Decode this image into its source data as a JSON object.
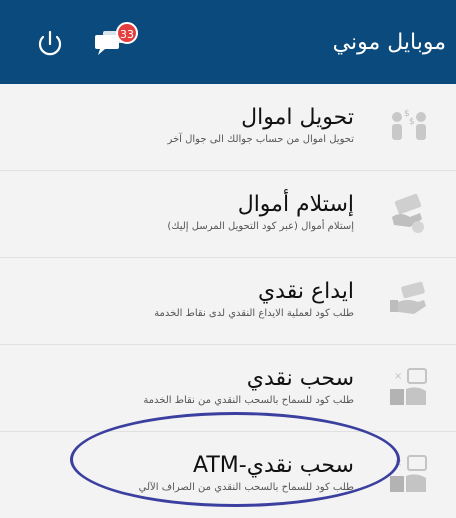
{
  "header": {
    "title": "موبايل موني",
    "notification_count": "33"
  },
  "items": [
    {
      "title": "تحويل اموال",
      "desc": "تحويل اموال من حساب جوالك الى جوال آخر",
      "icon": "money-transfer-icon"
    },
    {
      "title": "إستلام أموال",
      "desc": "إستلام أموال (عبر كود التحويل المرسل إليك)",
      "icon": "receive-money-icon"
    },
    {
      "title": "ايداع نقدي",
      "desc": "طلب كود لعملية الايداع النقدي لدى نقاط الخدمة",
      "icon": "cash-deposit-icon"
    },
    {
      "title": "سحب نقدي",
      "desc": "طلب كود للسماح بالسحب النقدي من نقاط الخدمة",
      "icon": "cash-withdraw-icon"
    },
    {
      "title": "سحب نقدي-ATM",
      "desc": "طلب كود للسماح بالسحب النقدي من الصراف الآلي",
      "icon": "atm-withdraw-icon"
    }
  ],
  "colors": {
    "header_bg": "#0b4a7c",
    "badge": "#e43f3f",
    "highlight": "#3b3f9f"
  }
}
